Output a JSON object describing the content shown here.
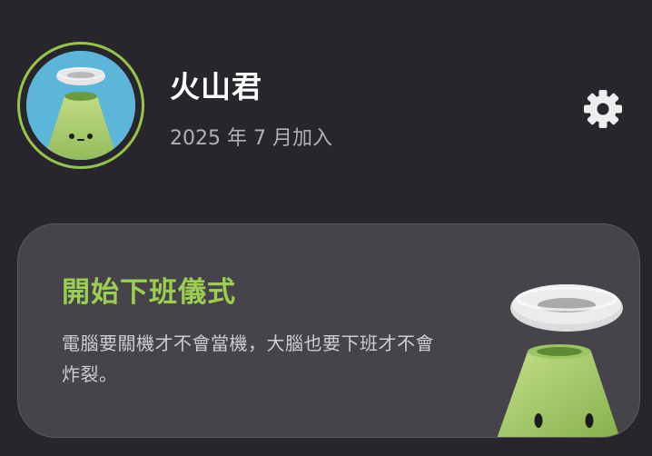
{
  "profile": {
    "name": "火山君",
    "join_date": "2025 年 7 月加入"
  },
  "card": {
    "title": "開始下班儀式",
    "description": "電腦要關機才不會當機，大腦也要下班才不會炸裂。"
  },
  "icons": {
    "settings": "gear-icon",
    "avatar": "volcano-mascot-icon",
    "card_illustration": "volcano-mascot-icon"
  },
  "colors": {
    "background": "#28262c",
    "accent_green": "#95c64b",
    "card_background": "#46444a",
    "avatar_background": "#5bb6d9"
  }
}
